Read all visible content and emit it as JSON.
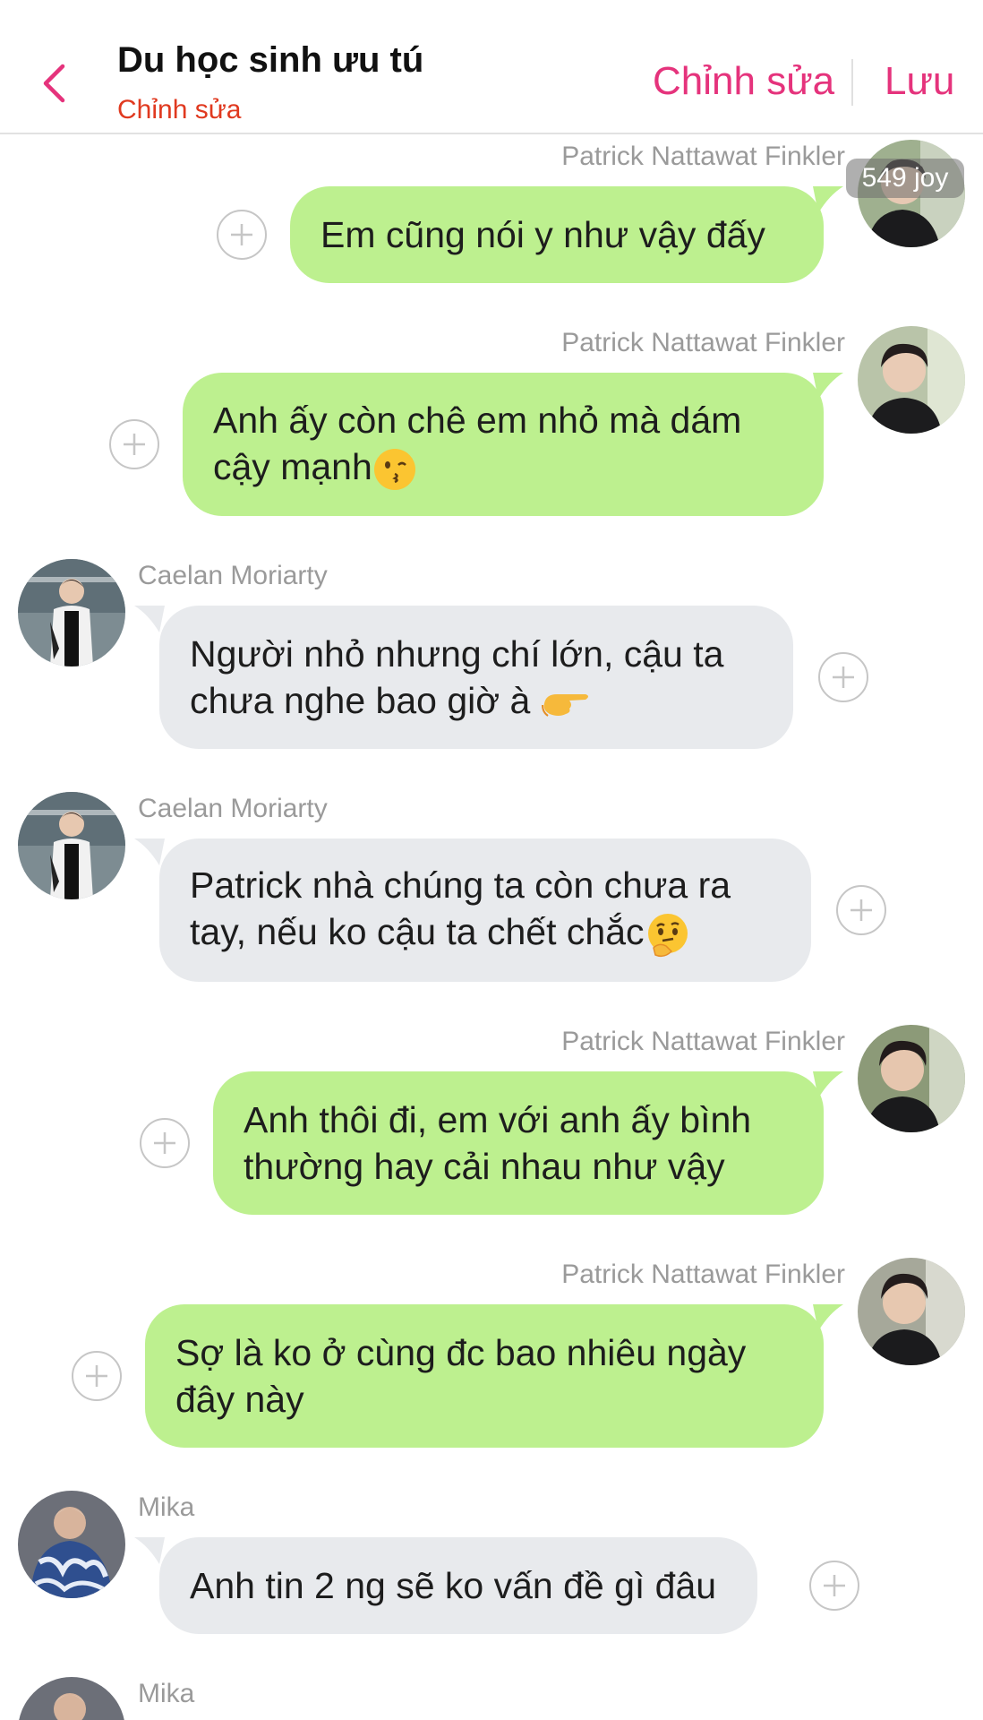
{
  "header": {
    "title": "Du học sinh ưu tú",
    "subtitle": "Chỉnh sửa",
    "edit_label": "Chỉnh sửa",
    "save_label": "Lưu",
    "back_icon": "chevron-left-icon",
    "accent_color": "#e5337c"
  },
  "badge": {
    "text": "549 joy"
  },
  "messages": [
    {
      "sender": "Patrick Nattawat Finkler",
      "side": "right",
      "line1": "Em cũng nói y như vậy đấy",
      "line2": ""
    },
    {
      "sender": "Patrick Nattawat Finkler",
      "side": "right",
      "line1": "Anh ấy còn chê em nhỏ mà dám",
      "line2": "cậy mạnh",
      "emoji": "kissing-face-emoji"
    },
    {
      "sender": "Caelan Moriarty",
      "side": "left",
      "line1": "Người nhỏ nhưng chí lớn, cậu ta",
      "line2": "chưa nghe bao giờ à ",
      "emoji": "pointing-right-emoji"
    },
    {
      "sender": "Caelan Moriarty",
      "side": "left",
      "line1": "Patrick nhà chúng ta còn chưa ra",
      "line2": "tay, nếu ko cậu ta chết chắc",
      "emoji": "thinking-face-emoji"
    },
    {
      "sender": "Patrick Nattawat Finkler",
      "side": "right",
      "line1": "Anh thôi đi, em với anh ấy bình",
      "line2": "thường hay cải nhau như vậy"
    },
    {
      "sender": "Patrick Nattawat Finkler",
      "side": "right",
      "line1": "Sợ là ko ở cùng đc bao nhiêu ngày",
      "line2": "đây này"
    },
    {
      "sender": "Mika",
      "side": "left",
      "line1": "Anh tin 2 ng sẽ ko vấn đề gì đâu",
      "line2": ""
    },
    {
      "sender": "Mika",
      "side": "left",
      "line1": "",
      "line2": ""
    }
  ],
  "colors": {
    "outgoing_bubble": "#bdf08f",
    "incoming_bubble": "#e8eaed",
    "name_text": "#9a9a9a",
    "subtitle": "#e0391f"
  }
}
